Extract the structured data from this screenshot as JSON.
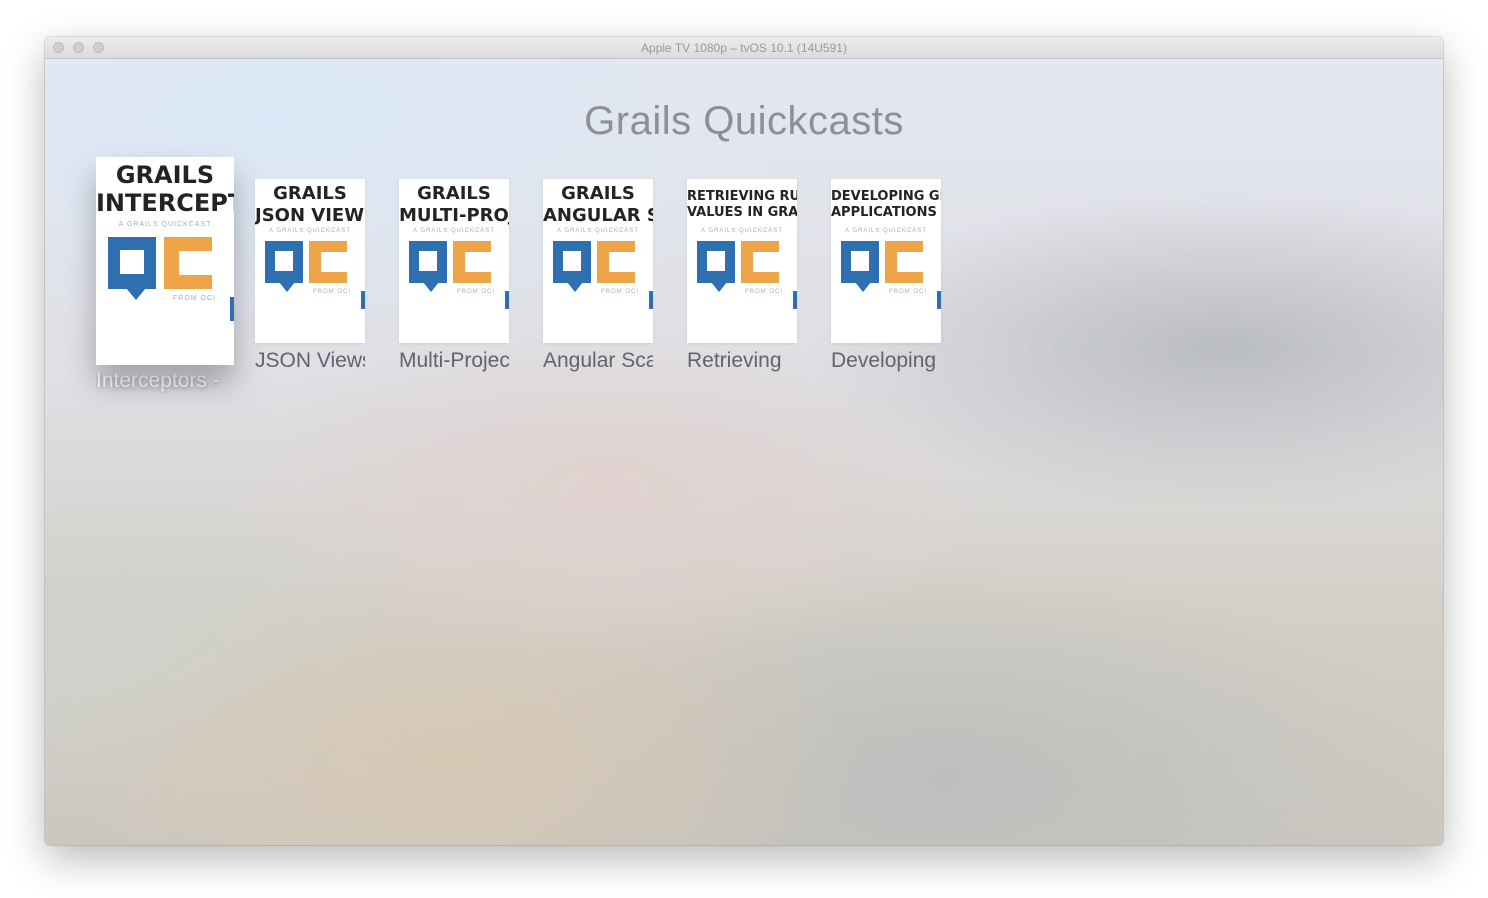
{
  "window": {
    "title": "Apple TV 1080p – tvOS 10.1 (14U591)"
  },
  "page": {
    "title": "Grails Quickcasts"
  },
  "colors": {
    "title_text": "#8c8f98",
    "logo_blue": "#2f6fb0",
    "logo_orange": "#f0a448"
  },
  "items": [
    {
      "label": "Interceptors -",
      "poster_line1": "GRAILS",
      "poster_line2": "INTERCEPTORS",
      "poster_sub": "A GRAILS QUICKCAST",
      "poster_from": "FROM OCI",
      "focused": true
    },
    {
      "label": "JSON Views",
      "poster_line1": "GRAILS",
      "poster_line2": "JSON VIEWS",
      "poster_sub": "A GRAILS QUICKCAST",
      "poster_from": "FROM OCI",
      "focused": false
    },
    {
      "label": "Multi-Project",
      "poster_line1": "GRAILS",
      "poster_line2": "MULTI-PROJECT BUILDS",
      "poster_sub": "A GRAILS QUICKCAST",
      "poster_from": "FROM OCI",
      "focused": false
    },
    {
      "label": "Angular Scaffolding",
      "poster_line1": "GRAILS",
      "poster_line2": "ANGULAR SCAFFOLDING",
      "poster_sub": "A GRAILS QUICKCAST",
      "poster_from": "FROM OCI",
      "focused": false
    },
    {
      "label": "Retrieving",
      "poster_line1": "RETRIEVING RUNTIME",
      "poster_line2": "VALUES IN GRAILS",
      "poster_sub": "A GRAILS QUICKCAST",
      "poster_from": "FROM OCI",
      "focused": false
    },
    {
      "label": "Developing",
      "poster_line1": "DEVELOPING GRAILS",
      "poster_line2": "APPLICATIONS WITH IntelliJ",
      "poster_sub": "A GRAILS QUICKCAST",
      "poster_from": "FROM OCI",
      "focused": false
    }
  ]
}
